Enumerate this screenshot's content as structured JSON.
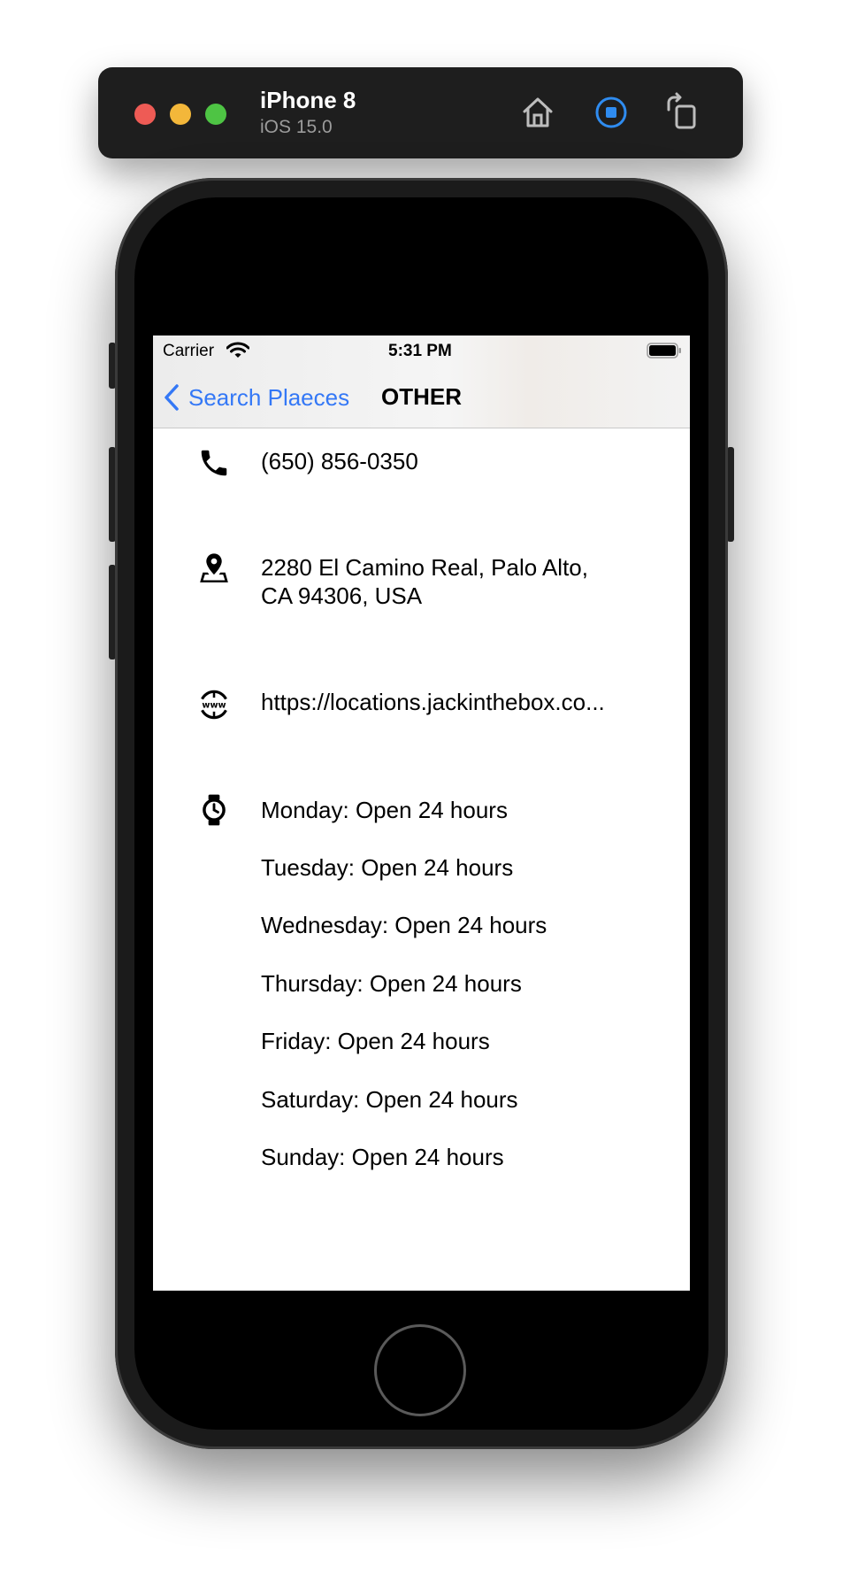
{
  "simulator": {
    "device_name": "iPhone 8",
    "os_version": "iOS 15.0"
  },
  "status_bar": {
    "carrier": "Carrier",
    "time": "5:31 PM"
  },
  "nav": {
    "back_label": "Search Plaeces",
    "title": "OTHER"
  },
  "details": {
    "phone": "(650) 856-0350",
    "address_line1": "2280 El Camino Real, Palo Alto,",
    "address_line2": "CA 94306, USA",
    "website": "https://locations.jackinthebox.co..."
  },
  "hours": [
    "Monday: Open 24 hours",
    "Tuesday: Open 24 hours",
    "Wednesday: Open 24 hours",
    "Thursday: Open 24 hours",
    "Friday: Open 24 hours",
    "Saturday: Open 24 hours",
    "Sunday: Open 24 hours"
  ],
  "icons": [
    "phone-icon",
    "map-pin-icon",
    "www-globe-icon",
    "watch-icon",
    "home-icon",
    "screenshot-icon",
    "rotate-icon",
    "wifi-icon",
    "battery-icon",
    "chevron-left-icon"
  ],
  "colors": {
    "accent": "#3478f6",
    "toolbar": "#1e1e1e",
    "traffic_red": "#ee5b55",
    "traffic_yellow": "#f3b73a",
    "traffic_green": "#4ec444"
  }
}
